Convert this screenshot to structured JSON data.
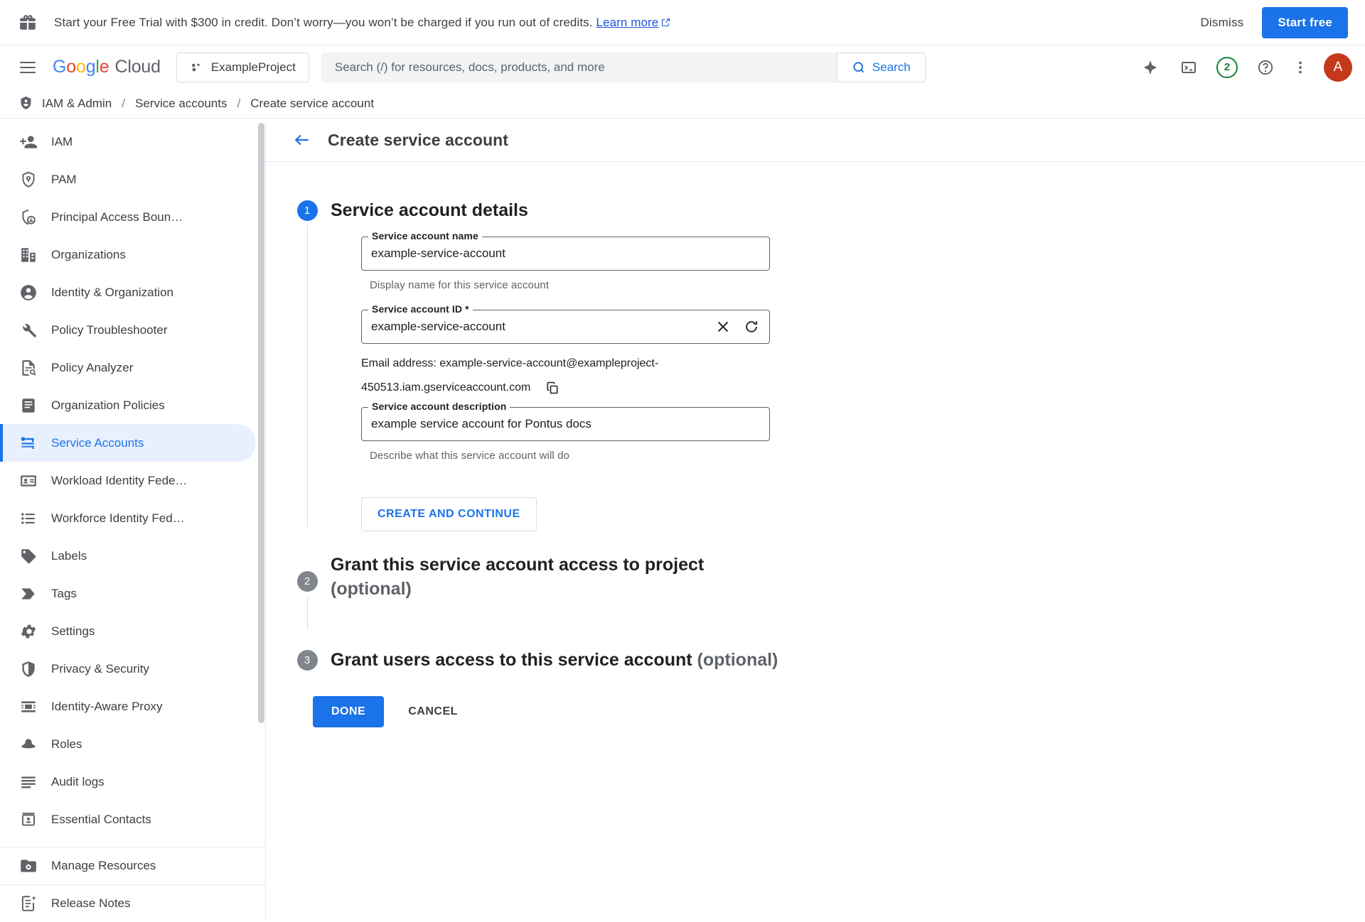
{
  "banner": {
    "icon": "gift-icon",
    "text": "Start your Free Trial with $300 in credit. Don’t worry—you won’t be charged if you run out of credits.",
    "link_label": "Learn more",
    "dismiss_label": "Dismiss",
    "cta_label": "Start free",
    "cta_color": "#1a73e8"
  },
  "appbar": {
    "menu_icon": "hamburger-menu-icon",
    "logo": {
      "g1": "G",
      "g2": "o",
      "g3": "o",
      "g4": "g",
      "g5": "l",
      "g6": "e",
      "product": "Cloud"
    },
    "project": {
      "icon": "project-dots-icon",
      "name": "ExampleProject"
    },
    "search": {
      "placeholder": "Search (/) for resources, docs, products, and more",
      "value": "",
      "button_label": "Search",
      "icon": "search-icon"
    },
    "actions": {
      "gemini_icon": "gemini-sparkle-icon",
      "cloud_shell_icon": "cloud-shell-terminal-icon",
      "notifications_count": "2",
      "notifications_color": "#188038",
      "help_icon": "help-question-icon",
      "more_icon": "kebab-more-icon",
      "avatar_initial": "A",
      "avatar_color": "#c5381a"
    }
  },
  "breadcrumb": {
    "icon": "iam-shield-person-icon",
    "items": [
      {
        "label": "IAM & Admin"
      },
      {
        "label": "Service accounts"
      },
      {
        "label": "Create service account"
      }
    ],
    "separator": "/"
  },
  "sidebar": {
    "items": [
      {
        "label": "IAM",
        "icon": "person-add-icon",
        "active": false
      },
      {
        "label": "PAM",
        "icon": "shield-key-icon",
        "active": false
      },
      {
        "label": "Principal Access Boun…",
        "icon": "shield-person-icon",
        "active": false
      },
      {
        "label": "Organizations",
        "icon": "building-icon",
        "active": false
      },
      {
        "label": "Identity & Organization",
        "icon": "account-circle-icon",
        "active": false
      },
      {
        "label": "Policy Troubleshooter",
        "icon": "wrench-icon",
        "active": false
      },
      {
        "label": "Policy Analyzer",
        "icon": "document-search-icon",
        "active": false
      },
      {
        "label": "Organization Policies",
        "icon": "policy-document-icon",
        "active": false
      },
      {
        "label": "Service Accounts",
        "icon": "service-account-key-icon",
        "active": true
      },
      {
        "label": "Workload Identity Fede…",
        "icon": "id-card-icon",
        "active": false
      },
      {
        "label": "Workforce Identity Fed…",
        "icon": "list-icon",
        "active": false
      },
      {
        "label": "Labels",
        "icon": "label-tag-icon",
        "active": false
      },
      {
        "label": "Tags",
        "icon": "tag-arrow-icon",
        "active": false
      },
      {
        "label": "Settings",
        "icon": "gear-icon",
        "active": false
      },
      {
        "label": "Privacy & Security",
        "icon": "shield-icon",
        "active": false
      },
      {
        "label": "Identity-Aware Proxy",
        "icon": "proxy-icon",
        "active": false
      },
      {
        "label": "Roles",
        "icon": "fedora-hat-icon",
        "active": false
      },
      {
        "label": "Audit logs",
        "icon": "audit-lines-icon",
        "active": false
      },
      {
        "label": "Essential Contacts",
        "icon": "contacts-icon",
        "active": false
      }
    ],
    "pinned": [
      {
        "label": "Manage Resources",
        "icon": "folder-gear-icon"
      },
      {
        "label": "Release Notes",
        "icon": "release-notes-icon"
      }
    ],
    "active_color": "#1a73e8",
    "active_bg": "#e8f0fe"
  },
  "page": {
    "back_icon": "arrow-back-icon",
    "title": "Create service account"
  },
  "steps": [
    {
      "number": "1",
      "title": "Service account details",
      "optional": "",
      "state": "active"
    },
    {
      "number": "2",
      "title": "Grant this service account access to project",
      "optional": "(optional)",
      "state": "inactive"
    },
    {
      "number": "3",
      "title": "Grant users access to this service account",
      "optional": "(optional)",
      "state": "inactive"
    }
  ],
  "form": {
    "name_field": {
      "label": "Service account name",
      "value": "example-service-account",
      "placeholder": "",
      "helper": "Display name for this service account"
    },
    "id_field": {
      "label": "Service account ID *",
      "value": "example-service-account",
      "placeholder": "",
      "clear_icon": "clear-x-icon",
      "refresh_icon": "refresh-icon"
    },
    "email_line": {
      "prefix": "Email address: ",
      "value": "example-service-account@exampleproject-450513.iam.gserviceaccount.com",
      "copy_icon": "copy-icon"
    },
    "description_field": {
      "label": "Service account description",
      "value": "example service account for Pontus docs",
      "placeholder": "",
      "helper": "Describe what this service account will do"
    },
    "create_continue_label": "CREATE AND CONTINUE"
  },
  "footer": {
    "done_label": "DONE",
    "cancel_label": "CANCEL",
    "done_color": "#1a73e8"
  }
}
